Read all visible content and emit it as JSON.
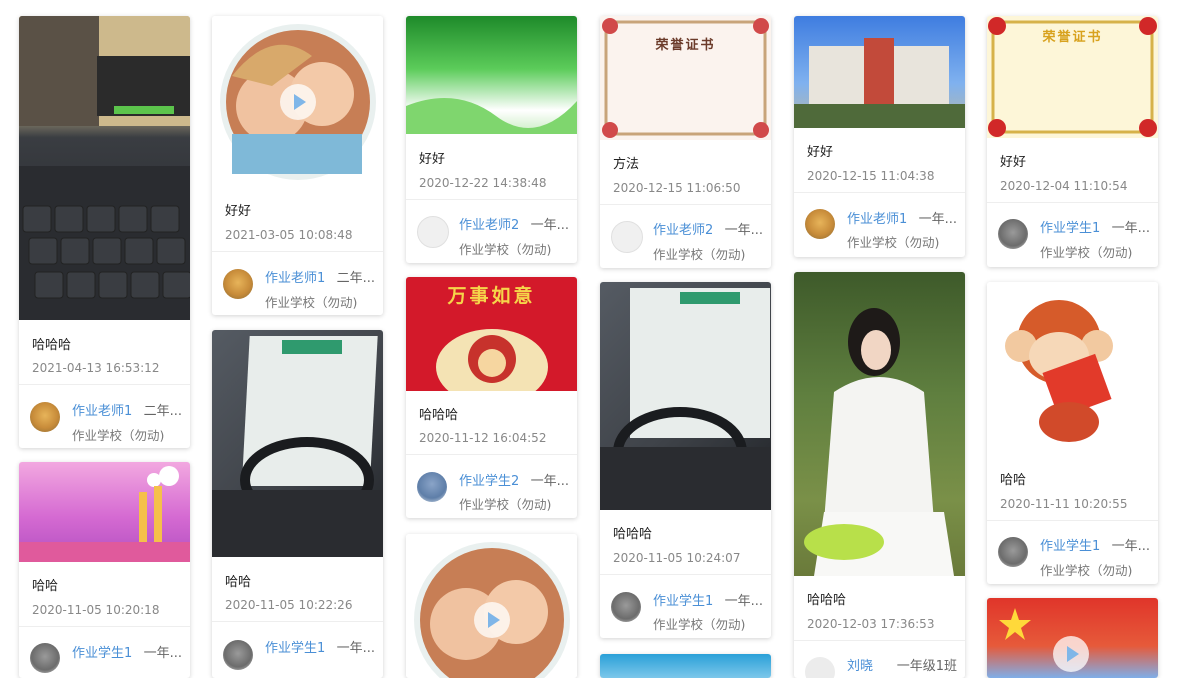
{
  "cards": [
    {
      "title": "哈哈哈",
      "time": "2021-04-13 16:53:12",
      "author": "作业老师1",
      "grade": "二年...",
      "school": "作业学校（勿动)"
    },
    {
      "title": "哈哈",
      "time": "2020-11-05 10:20:18",
      "author": "作业学生1",
      "grade": "一年..."
    },
    {
      "title": "好好",
      "time": "2021-03-05 10:08:48",
      "author": "作业老师1",
      "grade": "二年...",
      "school": "作业学校（勿动)"
    },
    {
      "title": "哈哈",
      "time": "2020-11-05 10:22:26",
      "author": "作业学生1",
      "grade": "一年..."
    },
    {
      "title": "好好",
      "time": "2020-12-22 14:38:48",
      "author": "作业老师2",
      "grade": "一年...",
      "school": "作业学校（勿动)"
    },
    {
      "title": "哈哈哈",
      "time": "2020-11-12 16:04:52",
      "author": "作业学生2",
      "grade": "一年...",
      "school": "作业学校（勿动)",
      "image_text": "万事如意"
    },
    {
      "title": "方法",
      "time": "2020-12-15 11:06:50",
      "author": "作业老师2",
      "grade": "一年...",
      "school": "作业学校（勿动)",
      "image_text": "荣誉证书"
    },
    {
      "title": "哈哈哈",
      "time": "2020-11-05 10:24:07",
      "author": "作业学生1",
      "grade": "一年...",
      "school": "作业学校（勿动)"
    },
    {
      "title": "好好",
      "time": "2020-12-15 11:04:38",
      "author": "作业老师1",
      "grade": "一年...",
      "school": "作业学校（勿动)"
    },
    {
      "title": "哈哈哈",
      "time": "2020-12-03 17:36:53",
      "author": "刘晓",
      "grade": "一年级1班"
    },
    {
      "title": "好好",
      "time": "2020-12-04 11:10:54",
      "author": "作业学生1",
      "grade": "一年...",
      "school": "作业学校（勿动)",
      "image_text": "荣誉证书"
    },
    {
      "title": "哈哈",
      "time": "2020-11-11 10:20:55",
      "author": "作业学生1",
      "grade": "一年...",
      "school": "作业学校（勿动)"
    }
  ],
  "colors": {
    "author_link": "#4a8fd6",
    "card_bg": "#ffffff",
    "page_bg": "#ffffff"
  },
  "icons": {
    "play": "play-icon"
  }
}
